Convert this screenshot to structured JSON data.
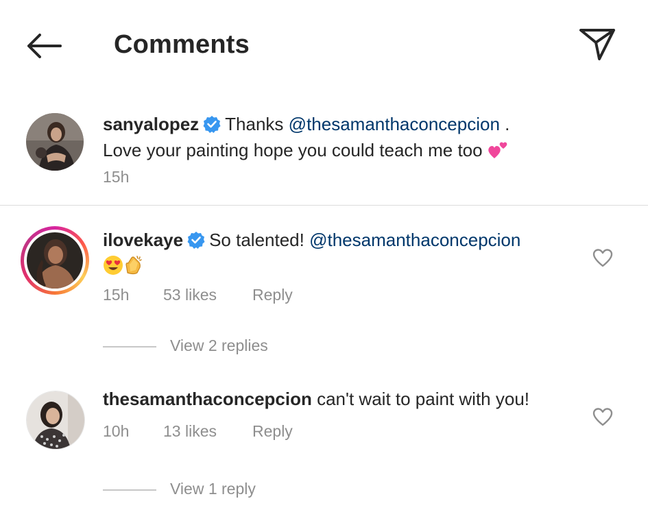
{
  "header": {
    "title": "Comments",
    "back_icon": "arrow-left-icon",
    "send_icon": "paper-plane-icon"
  },
  "caption": {
    "username": "sanyalopez",
    "verified": true,
    "text_before_mention": "Thanks ",
    "mention": "@thesamanthaconcepcion",
    "text_after_mention": " .",
    "text_line2": "Love your painting hope you could teach me too",
    "emoji": "two-hearts-emoji",
    "time": "15h"
  },
  "comments": [
    {
      "username": "ilovekaye",
      "verified": true,
      "has_story": true,
      "text_before_mention": "So talented! ",
      "mention": "@thesamanthaconcepcion",
      "emojis": [
        "heart-eyes-emoji",
        "clapping-hands-emoji"
      ],
      "time": "15h",
      "likes": "53 likes",
      "reply_label": "Reply",
      "view_replies_label": "View 2 replies"
    },
    {
      "username": "thesamanthaconcepcion",
      "verified": false,
      "has_story": false,
      "text": "can't wait to paint with you!",
      "time": "10h",
      "likes": "13 likes",
      "reply_label": "Reply",
      "view_replies_label": "View 1 reply"
    }
  ],
  "colors": {
    "text": "#262626",
    "secondary": "#8e8e8e",
    "mention": "#00376b",
    "verified_blue": "#3897f0",
    "divider": "#dbdbdb"
  }
}
